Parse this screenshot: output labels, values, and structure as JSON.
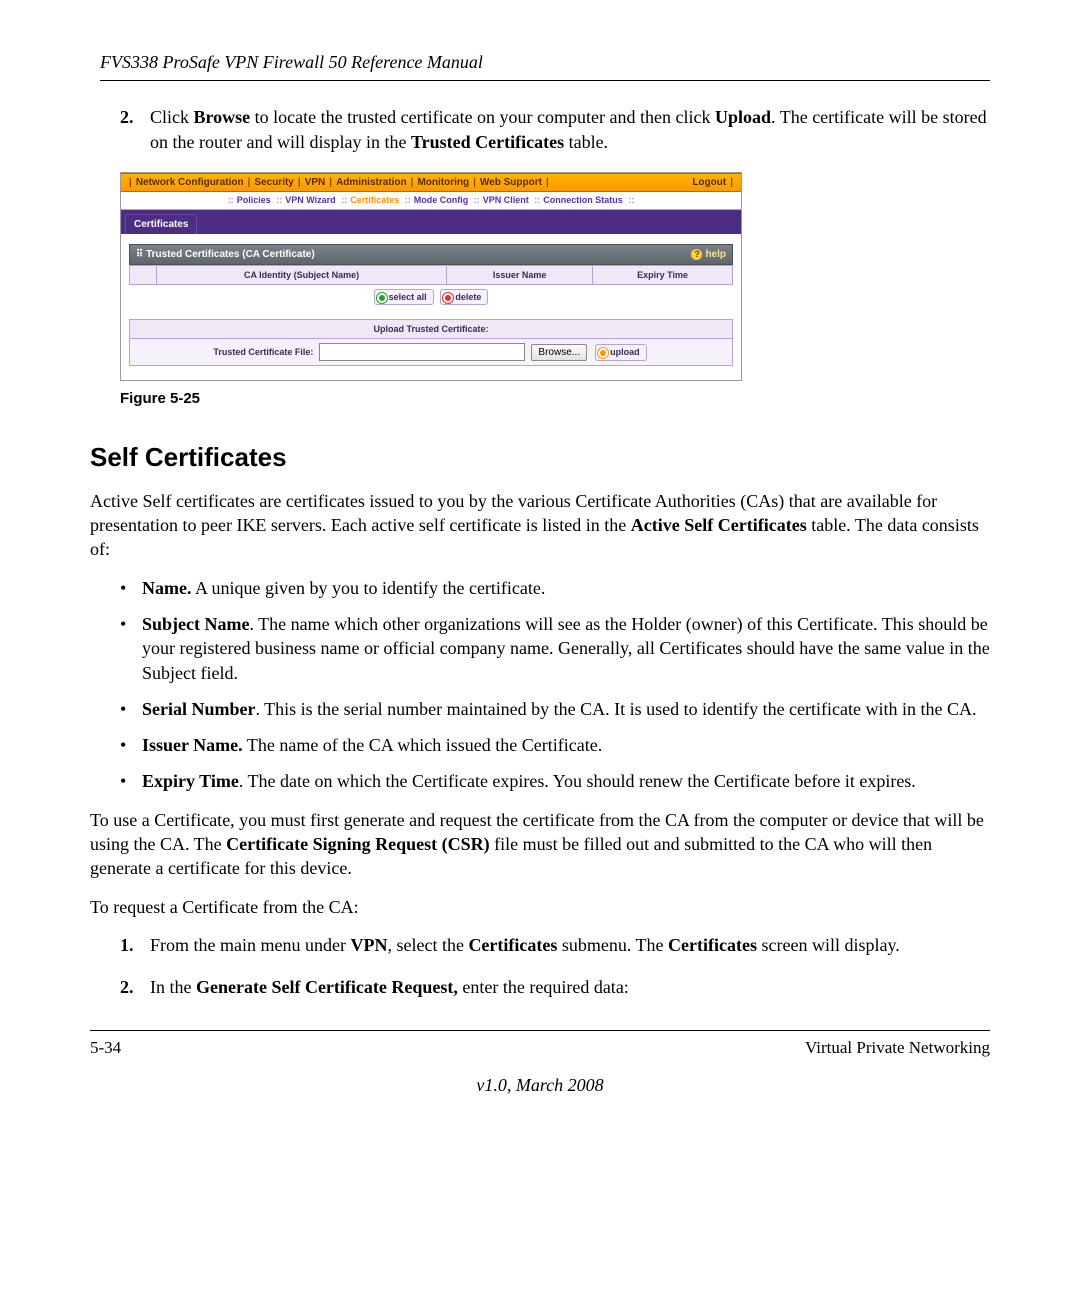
{
  "header": {
    "running_title": "FVS338 ProSafe VPN Firewall 50 Reference Manual"
  },
  "step2": {
    "num": "2.",
    "pre": "Click ",
    "b1": "Browse",
    "mid1": " to locate the trusted certificate on your computer and then click ",
    "b2": "Upload",
    "mid2": ". The certificate will be stored on the router and will display in the ",
    "b3": "Trusted Certificates",
    "tail": " table."
  },
  "figure": {
    "caption": "Figure 5-25",
    "topnav": [
      "Network Configuration",
      "Security",
      "VPN",
      "Administration",
      "Monitoring",
      "Web Support",
      "Logout"
    ],
    "subnav": [
      "Policies",
      "VPN Wizard",
      "Certificates",
      "Mode Config",
      "VPN Client",
      "Connection Status"
    ],
    "subnav_selected_index": 2,
    "tab": "Certificates",
    "panel_title": "Trusted Certificates (CA Certificate)",
    "help": "help",
    "cols": [
      "CA Identity (Subject Name)",
      "Issuer Name",
      "Expiry Time"
    ],
    "btn_select_all": "select all",
    "btn_delete": "delete",
    "upload_head": "Upload Trusted Certificate:",
    "upload_label": "Trusted Certificate File:",
    "browse": "Browse...",
    "upload": "upload"
  },
  "section_title": "Self Certificates",
  "p1": {
    "t1": "Active Self certificates are certificates issued to you by the various Certificate Authorities (CAs) that are available for presentation to peer IKE servers. Each active self certificate is listed in the ",
    "b1": "Active Self Certificates",
    "t2": " table. The data consists of:"
  },
  "bullets": {
    "name_b": "Name.",
    "name_t": " A unique given by you to identify the certificate.",
    "subj_b": "Subject Name",
    "subj_t": ". The name which other organizations will see as the Holder (owner) of this Certificate. This should be your registered business name or official company name. Generally, all Certificates should have the same value in the Subject field.",
    "sn_b": "Serial Number",
    "sn_t": ". This is the serial number maintained by the CA. It is used to identify the certificate with in the CA.",
    "iss_b": "Issuer Name.",
    "iss_t": " The name of the CA which issued the Certificate.",
    "exp_b": "Expiry Time",
    "exp_t": ". The date on which the Certificate expires. You should renew the Certificate before it expires."
  },
  "p2": {
    "t1": "To use a Certificate, you must first generate and request the certificate from the CA from the computer or device that will be using the CA. The ",
    "b1": "Certificate Signing Request (CSR)",
    "t2": " file must be filled out and submitted to the CA who will then generate a certificate for this device."
  },
  "p3": "To request a Certificate from the CA:",
  "ol1": {
    "num": "1.",
    "t1": "From the main menu under ",
    "b1": "VPN",
    "t2": ", select the ",
    "b2": "Certificates",
    "t3": " submenu. The ",
    "b3": "Certificates",
    "t4": " screen will display."
  },
  "ol2": {
    "num": "2.",
    "t1": "In the ",
    "b1": "Generate Self Certificate Request,",
    "t2": " enter the required data:"
  },
  "footer": {
    "page": "5-34",
    "chapter": "Virtual Private Networking",
    "version": "v1.0, March 2008"
  }
}
